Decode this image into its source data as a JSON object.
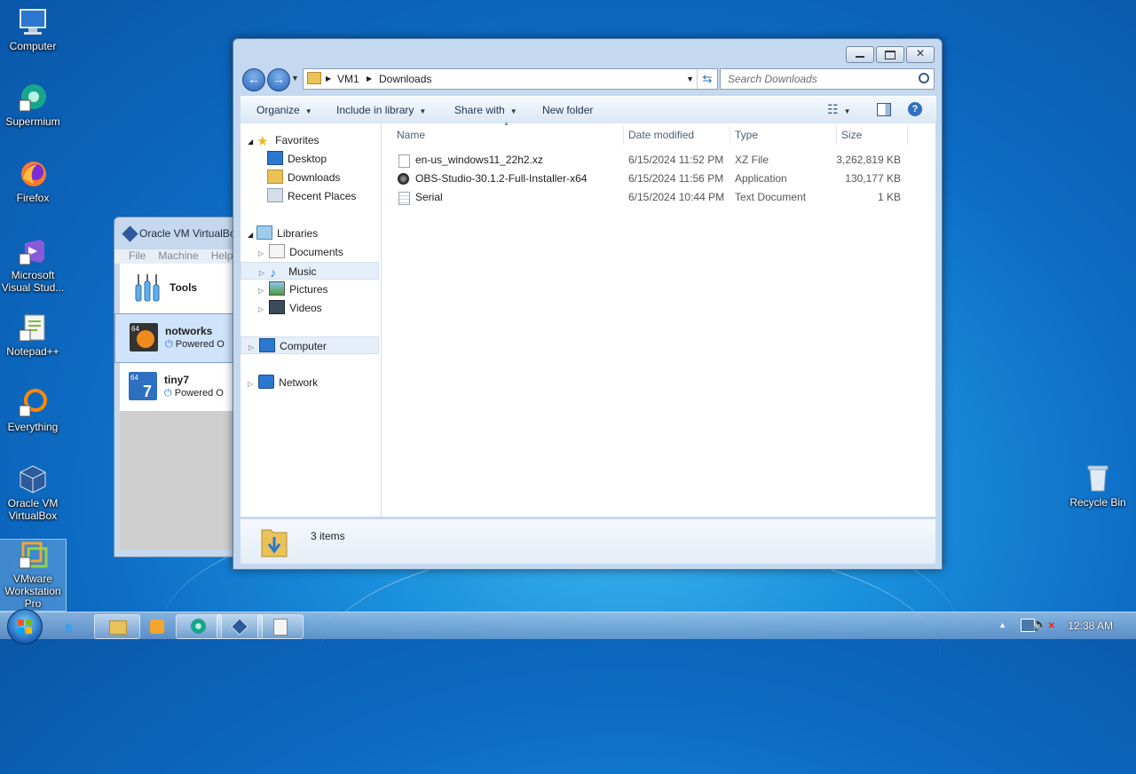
{
  "desktop": {
    "icons": [
      {
        "label": "Computer"
      },
      {
        "label": "Supermium"
      },
      {
        "label": "Firefox"
      },
      {
        "label": "Microsoft Visual Stud..."
      },
      {
        "label": "Notepad++"
      },
      {
        "label": "Everything"
      },
      {
        "label": "Oracle VM VirtualBox"
      },
      {
        "label": "VMware Workstation Pro"
      },
      {
        "label": "Recycle Bin"
      }
    ]
  },
  "virtualbox": {
    "title": "Oracle VM VirtualBo",
    "menu": [
      "File",
      "Machine",
      "Help"
    ],
    "items": [
      {
        "name": "Tools",
        "status": ""
      },
      {
        "name": "notworks",
        "status": "Powered O"
      },
      {
        "name": "tiny7",
        "status": "Powered O"
      }
    ]
  },
  "explorer": {
    "address": [
      "VM1",
      "Downloads"
    ],
    "search_placeholder": "Search Downloads",
    "toolbar": {
      "organize": "Organize",
      "include": "Include in library",
      "share": "Share with",
      "new_folder": "New folder"
    },
    "nav": {
      "favorites": "Favorites",
      "desktop": "Desktop",
      "downloads": "Downloads",
      "recent": "Recent Places",
      "libraries": "Libraries",
      "documents": "Documents",
      "music": "Music",
      "pictures": "Pictures",
      "videos": "Videos",
      "computer": "Computer",
      "network": "Network"
    },
    "columns": {
      "name": "Name",
      "date": "Date modified",
      "type": "Type",
      "size": "Size"
    },
    "files": [
      {
        "name": "en-us_windows11_22h2.xz",
        "date": "6/15/2024 11:52 PM",
        "type": "XZ File",
        "size": "3,262,819 KB",
        "icon": "file-icon"
      },
      {
        "name": "OBS-Studio-30.1.2-Full-Installer-x64",
        "date": "6/15/2024 11:56 PM",
        "type": "Application",
        "size": "130,177 KB",
        "icon": "obs-icon"
      },
      {
        "name": "Serial",
        "date": "6/15/2024 10:44 PM",
        "type": "Text Document",
        "size": "1 KB",
        "icon": "text-file-icon"
      }
    ],
    "status": "3 items"
  },
  "taskbar": {
    "clock": "12:38 AM"
  }
}
